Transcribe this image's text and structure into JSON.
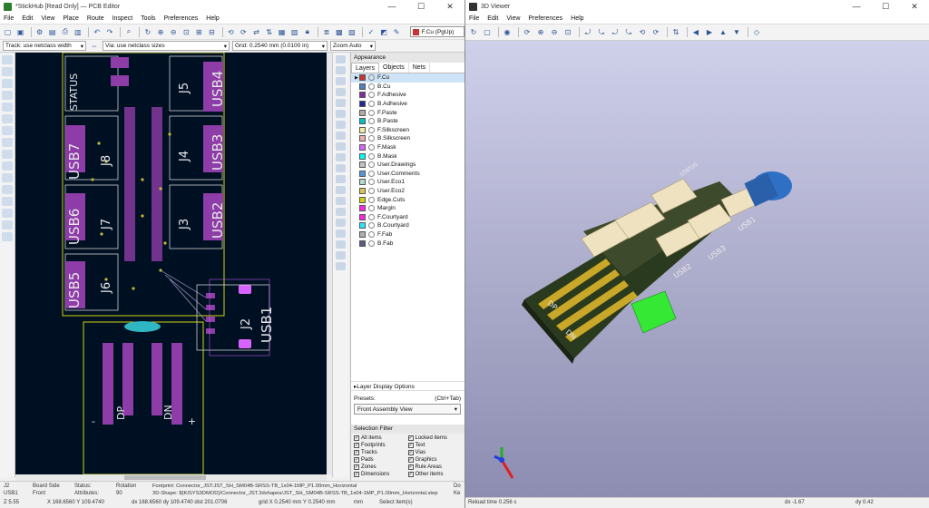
{
  "pcb_window": {
    "title": "*StickHub [Read Only] — PCB Editor",
    "menu": [
      "File",
      "Edit",
      "View",
      "Place",
      "Route",
      "Inspect",
      "Tools",
      "Preferences",
      "Help"
    ],
    "track_width": "Track: use netclass width",
    "via_size": "Via: use netclass sizes",
    "grid": "Grid: 0.2540 mm (0.0100 in)",
    "zoom": "Zoom Auto",
    "active_layer": "F.Cu (PgUp)",
    "board_labels": {
      "usb1": "USB1",
      "usb2": "USB2",
      "usb3": "USB3",
      "usb4": "USB4",
      "usb5": "USB5",
      "usb6": "USB6",
      "usb7": "USB7",
      "j2": "J2",
      "j3": "J3",
      "j4": "J4",
      "j5": "J5",
      "j6": "J6",
      "j7": "J7",
      "j8": "J8",
      "status": "STATUS",
      "dp": "DP",
      "dn": "DN",
      "minus": "-",
      "plus": "+"
    }
  },
  "appearance": {
    "header": "Appearance",
    "tabs": [
      "Layers",
      "Objects",
      "Nets"
    ],
    "layers": [
      {
        "name": "F.Cu",
        "color": "#c83434",
        "selected": true
      },
      {
        "name": "B.Cu",
        "color": "#4d7fc4"
      },
      {
        "name": "F.Adhesive",
        "color": "#842ca1"
      },
      {
        "name": "B.Adhesive",
        "color": "#1f2896"
      },
      {
        "name": "F.Paste",
        "color": "#b4a8a8"
      },
      {
        "name": "B.Paste",
        "color": "#00c2c2"
      },
      {
        "name": "F.Silkscreen",
        "color": "#f2eda1"
      },
      {
        "name": "B.Silkscreen",
        "color": "#e8b2a7"
      },
      {
        "name": "F.Mask",
        "color": "#d864ff"
      },
      {
        "name": "B.Mask",
        "color": "#02ffee"
      },
      {
        "name": "User.Drawings",
        "color": "#c2c2c2"
      },
      {
        "name": "User.Comments",
        "color": "#5994dc"
      },
      {
        "name": "User.Eco1",
        "color": "#b4dbd2"
      },
      {
        "name": "User.Eco2",
        "color": "#d8c852"
      },
      {
        "name": "Edge.Cuts",
        "color": "#d0d210"
      },
      {
        "name": "Margin",
        "color": "#ff26e2"
      },
      {
        "name": "F.Courtyard",
        "color": "#ff26e2"
      },
      {
        "name": "B.Courtyard",
        "color": "#26e9ff"
      },
      {
        "name": "F.Fab",
        "color": "#afafaf"
      },
      {
        "name": "B.Fab",
        "color": "#585d84"
      }
    ],
    "layer_display_options": "Layer Display Options",
    "presets_label": "Presets:",
    "presets_shortcut": "(Ctrl+Tab)",
    "preset_value": "Front Assembly View"
  },
  "selection_filter": {
    "header": "Selection Filter",
    "items": [
      "All items",
      "Locked items",
      "Footprints",
      "Text",
      "Tracks",
      "Vias",
      "Pads",
      "Graphics",
      "Zones",
      "Rule Areas",
      "Dimensions",
      "Other items"
    ]
  },
  "status": {
    "ref_label": "J2",
    "ref_value": "USB1",
    "board_side_label": "Board Side",
    "board_side": "Front",
    "status_label": "Status:",
    "attributes_label": "Attributes:",
    "rotation_label": "Rotation",
    "rotation": "90",
    "footprint": "Footprint: Connector_JST:JST_SH_SM04B-SRSS-TB_1x04-1MP_P1.00mm_Horizontal",
    "shape3d": "3D-Shape: ${KISYS3DMOD}/Connector_JST.3dshapes/JST_SH_SM04B-SRSS-TB_1x04-1MP_P1.00mm_Horizontal.step",
    "key_label": "Do",
    "key_label2": "Ke",
    "zoom": "Z 5.55",
    "xy": "X 168.6560  Y 109.4740",
    "dxy": "dx 168.6560  dy 109.4740  dist 201.0706",
    "grid": "grid X 0.2540 mm  Y 0.2540 mm",
    "units": "mm",
    "sel": "Select item(s)"
  },
  "viewer": {
    "title": "3D Viewer",
    "menu": [
      "File",
      "Edit",
      "View",
      "Preferences",
      "Help"
    ],
    "reload": "Reload time 0.256 s",
    "dx": "dx -1.67",
    "dy": "dy 0.42",
    "labels": {
      "dp": "DP",
      "dn": "DN",
      "usb1": "USB1",
      "usb2": "USB2",
      "usb3": "USB3",
      "status": "STATUS"
    }
  }
}
